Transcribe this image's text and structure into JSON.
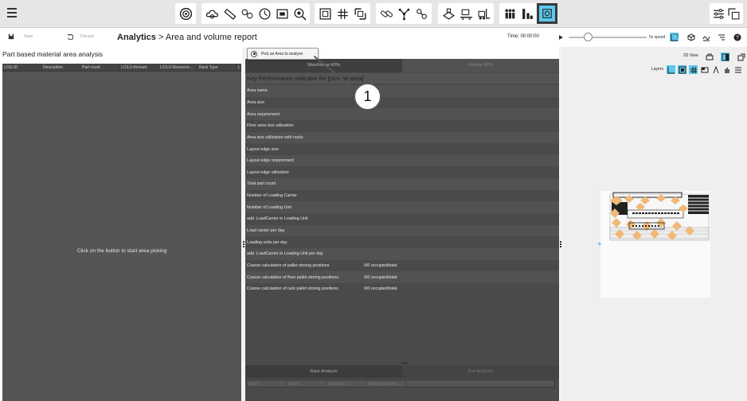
{
  "toolbar": {
    "groups": [
      [
        "target-icon"
      ],
      [
        "cloud-gear-icon",
        "ruler-icon",
        "connect-icon",
        "clock-icon",
        "area-icon",
        "zoom-gear-icon"
      ],
      [
        "frame-icon",
        "grid-icon",
        "resize-icon"
      ],
      [
        "link-icon",
        "network-icon",
        "chain-icon"
      ],
      [
        "box-hand-icon",
        "conveyor-icon",
        "forklift-icon"
      ],
      [
        "people-icon",
        "stack-icon",
        "analytics-icon"
      ]
    ],
    "selected": "analytics-icon",
    "accent": "#5cc9ec"
  },
  "subbar": {
    "save_label": "Save",
    "discard_label": "Discard",
    "breadcrumb_root": "Analytics",
    "breadcrumb_sep": ">",
    "breadcrumb_page": "Area and volume report",
    "time_label": "Time: 00:00:00",
    "speed_label": "0x speed"
  },
  "left": {
    "title": "Part based material area analysis",
    "columns": [
      "LOG-ID",
      "Description",
      "Part count",
      "LC/LU Amount",
      "LC/LU Resource…",
      "Rack Type",
      "LI"
    ],
    "empty_message": "Click on the button to start area picking"
  },
  "pick": {
    "button_label": "Pick an Area to analyse",
    "callout_number": "1"
  },
  "middle": {
    "tabs": [
      "Warehouse KPIs",
      "Volume KPIs"
    ],
    "kpi_header": "Key Performance Indicator for [pick an area]",
    "rows": [
      {
        "label": "Area name",
        "value": ""
      },
      {
        "label": "Area size",
        "value": ""
      },
      {
        "label": "Area requirement",
        "value": ""
      },
      {
        "label": "Floor area size utilization",
        "value": ""
      },
      {
        "label": "Area size utilization with racks",
        "value": ""
      },
      {
        "label": "Layout edge size",
        "value": ""
      },
      {
        "label": "Layout edge requirement",
        "value": ""
      },
      {
        "label": "Layout edge utilization",
        "value": ""
      },
      {
        "label": "Total part count",
        "value": ""
      },
      {
        "label": "Number of Loading Carrier",
        "value": ""
      },
      {
        "label": "Number of Loading Unit",
        "value": ""
      },
      {
        "label": "add. LoadCarrier in Loading Unit",
        "value": ""
      },
      {
        "label": "Load carrier per day",
        "value": ""
      },
      {
        "label": "Loading units per day",
        "value": ""
      },
      {
        "label": "add. LoadCarrier in Loading Unit per day",
        "value": ""
      },
      {
        "label": "Coarse calculation of pallet storing positions",
        "value": "0/0 occupied/total"
      },
      {
        "label": "Coarse calculation of floor pallet storing positions",
        "value": "0/0 occupied/total"
      },
      {
        "label": "Coarse calculation of rack pallet storing positions",
        "value": "0/0 occupied/total"
      }
    ],
    "bottom_tabs": [
      "Rack Analysis",
      "Box Analysis"
    ],
    "bottom_columns": [
      "Rack",
      "Count",
      "Utilization …",
      "Pallets positions …"
    ]
  },
  "right": {
    "view_label": "2D View",
    "layers_label": "Layers"
  }
}
